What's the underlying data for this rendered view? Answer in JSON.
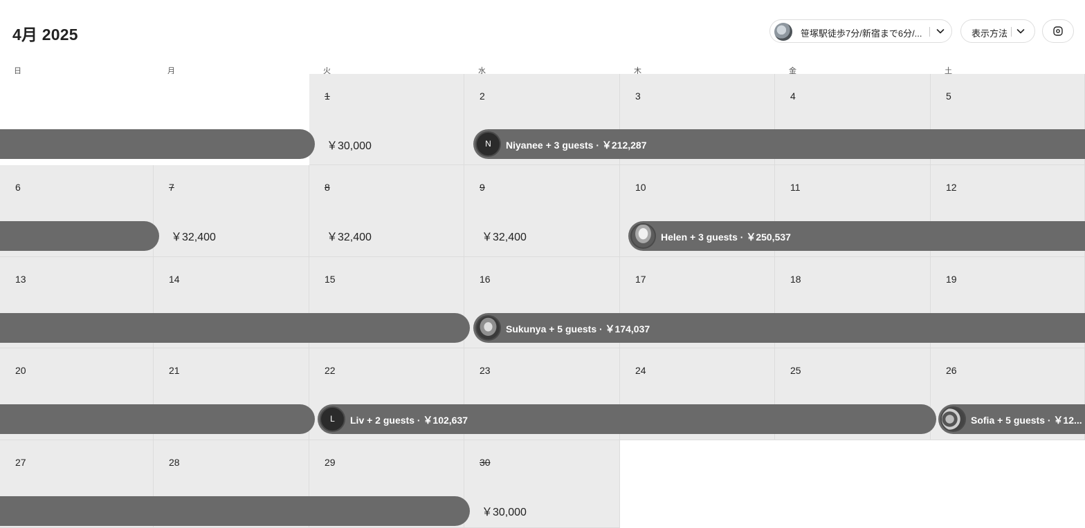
{
  "header": {
    "month_title": "4月 2025",
    "listing_label": "笹塚駅徒歩7分/新宿まで6分/...",
    "view_label": "表示方法"
  },
  "weekdays": [
    "日",
    "月",
    "火",
    "水",
    "木",
    "金",
    "土"
  ],
  "weeks": [
    [
      {
        "empty": true
      },
      {
        "empty": true
      },
      {
        "day": "1",
        "past": true,
        "price": "￥30,000"
      },
      {
        "day": "2"
      },
      {
        "day": "3"
      },
      {
        "day": "4"
      },
      {
        "day": "5"
      }
    ],
    [
      {
        "day": "6"
      },
      {
        "day": "7",
        "past": true,
        "price": "￥32,400"
      },
      {
        "day": "8",
        "past": true,
        "price": "￥32,400"
      },
      {
        "day": "9",
        "past": true,
        "price": "￥32,400"
      },
      {
        "day": "10"
      },
      {
        "day": "11"
      },
      {
        "day": "12"
      }
    ],
    [
      {
        "day": "13"
      },
      {
        "day": "14"
      },
      {
        "day": "15"
      },
      {
        "day": "16"
      },
      {
        "day": "17"
      },
      {
        "day": "18"
      },
      {
        "day": "19"
      }
    ],
    [
      {
        "day": "20"
      },
      {
        "day": "21"
      },
      {
        "day": "22"
      },
      {
        "day": "23"
      },
      {
        "day": "24"
      },
      {
        "day": "25"
      },
      {
        "day": "26"
      }
    ],
    [
      {
        "day": "27"
      },
      {
        "day": "28"
      },
      {
        "day": "29"
      },
      {
        "day": "30",
        "past": true,
        "price": "￥30,000"
      },
      {
        "empty": true
      },
      {
        "empty": true
      },
      {
        "empty": true
      }
    ]
  ],
  "reservations": [
    {
      "text": "",
      "initial": "",
      "avatar": "none"
    },
    {
      "text": "Niyanee + 3 guests · ￥212,287",
      "initial": "N",
      "avatar": "letter"
    },
    {
      "text": "",
      "initial": "",
      "avatar": "none"
    },
    {
      "text": "Helen + 3 guests · ￥250,537",
      "initial": "",
      "avatar": "photo1"
    },
    {
      "text": "",
      "initial": "",
      "avatar": "none"
    },
    {
      "text": "Sukunya + 5 guests · ￥174,037",
      "initial": "",
      "avatar": "photo2"
    },
    {
      "text": "",
      "initial": "",
      "avatar": "none"
    },
    {
      "text": "Liv + 2 guests · ￥102,637",
      "initial": "L",
      "avatar": "letter"
    },
    {
      "text": "Sofia + 5 guests · ￥12...",
      "initial": "",
      "avatar": "photo3"
    },
    {
      "text": "",
      "initial": "",
      "avatar": "none"
    }
  ],
  "colors": {
    "cell_background": "#ebebeb",
    "reservation_bar": "#6a6a6a",
    "text": "#222222"
  }
}
